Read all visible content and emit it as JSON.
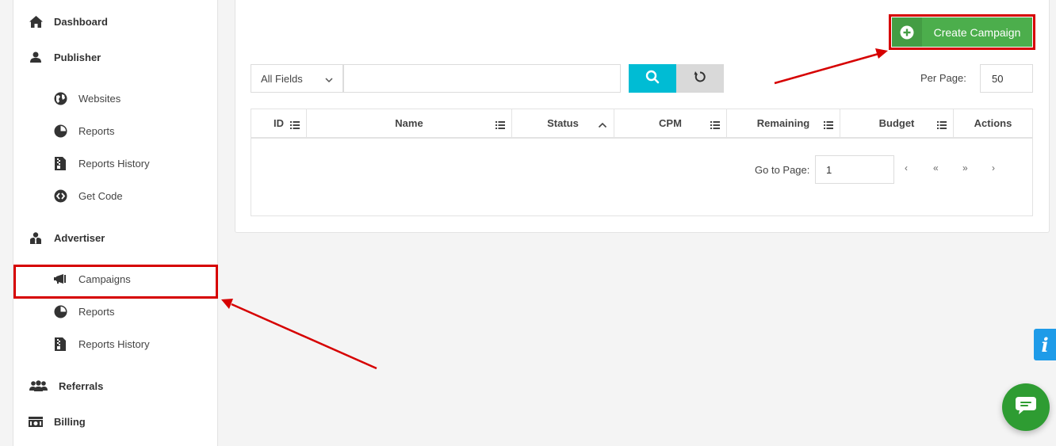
{
  "sidebar": {
    "dashboard": "Dashboard",
    "publisher": "Publisher",
    "publisher_items": [
      "Websites",
      "Reports",
      "Reports History",
      "Get Code"
    ],
    "advertiser": "Advertiser",
    "advertiser_items": [
      "Campaigns",
      "Reports",
      "Reports History"
    ],
    "referrals": "Referrals",
    "billing": "Billing"
  },
  "toolbar": {
    "create_label": "Create Campaign",
    "field_select_value": "All Fields",
    "search_value": "",
    "per_page_label": "Per Page:",
    "per_page_value": "50"
  },
  "table": {
    "columns": [
      "ID",
      "Name",
      "Status",
      "CPM",
      "Remaining",
      "Budget",
      "Actions"
    ],
    "rows": []
  },
  "pager": {
    "label": "Go to Page:",
    "page_value": "1",
    "links": [
      "‹",
      "«",
      "»",
      "›"
    ]
  },
  "colors": {
    "accent_cyan": "#00bcd4",
    "create_green": "#4cae4c",
    "annotation_red": "#d60000",
    "chat_green": "#2e9c32",
    "info_blue": "#1e9be8"
  },
  "widgets": {
    "info_glyph": "i"
  }
}
